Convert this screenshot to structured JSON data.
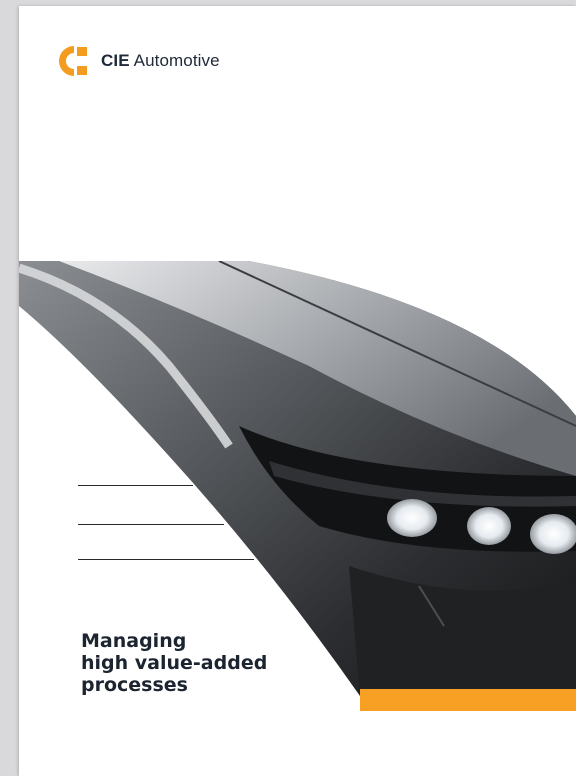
{
  "brand": {
    "name_bold": "CIE",
    "name_light": "Automotive",
    "accent_color": "#f39c1f",
    "text_color": "#1f2937"
  },
  "cover": {
    "title_lines": [
      "Managing",
      "high value-added",
      "processes"
    ],
    "hero_image": "car-headlight-photo",
    "accent_bar_color": "#f7a024"
  }
}
